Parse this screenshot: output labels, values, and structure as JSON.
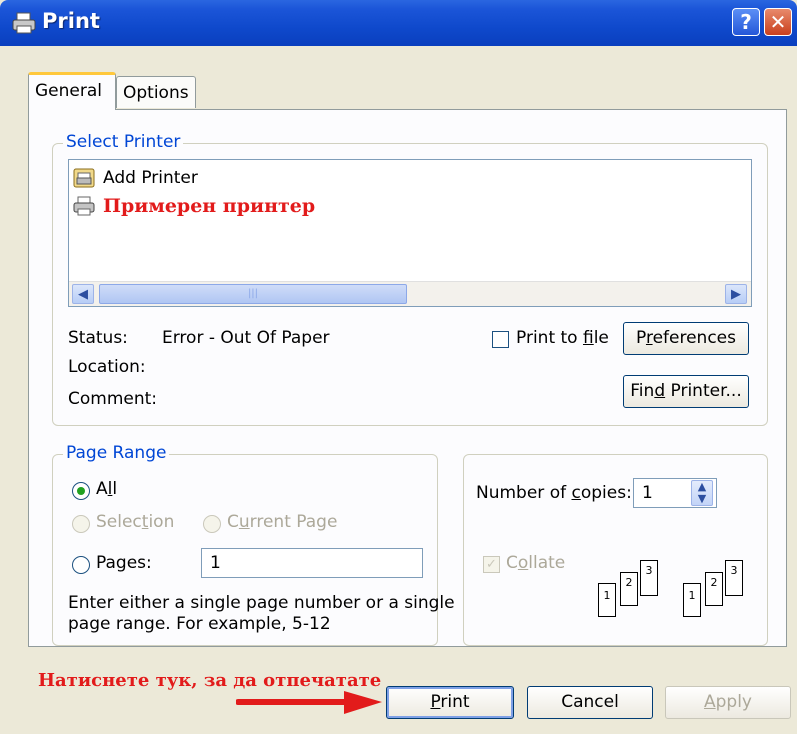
{
  "window": {
    "title": "Print",
    "help_glyph": "?",
    "close_glyph": "✕"
  },
  "tabs": [
    {
      "label": "General",
      "active": true
    },
    {
      "label": "Options",
      "active": false
    }
  ],
  "select_printer": {
    "legend": "Select Printer",
    "items": [
      {
        "label": "Add Printer",
        "icon": "add-printer-icon"
      },
      {
        "label": "Примерен принтер",
        "icon": "printer-icon",
        "color": "#e21b1b"
      }
    ],
    "status_label": "Status:",
    "status_value": "Error - Out Of Paper",
    "location_label": "Location:",
    "comment_label": "Comment:",
    "print_to_file": {
      "label_pre": "Print to ",
      "label_u": "f",
      "label_post": "ile",
      "checked": false
    },
    "preferences": {
      "label_pre": "P",
      "label_u": "r",
      "label_post": "eferences"
    },
    "find_printer": {
      "label_pre": "Fin",
      "label_u": "d",
      "label_post": " Printer..."
    }
  },
  "page_range": {
    "legend": "Page Range",
    "all": {
      "label_pre": "A",
      "label_u": "l",
      "label_post": "l",
      "checked": true
    },
    "selection": {
      "label_pre": "Selec",
      "label_u": "t",
      "label_post": "ion",
      "enabled": false
    },
    "current_page": {
      "label_pre": "C",
      "label_u": "u",
      "label_post": "rrent Page",
      "enabled": false
    },
    "pages": {
      "label": "Pages:",
      "value": "1"
    },
    "hint_line1": "Enter either a single page number or a single",
    "hint_line2": "page range.  For example, 5-12"
  },
  "copies": {
    "label_pre": "Number of ",
    "label_u": "c",
    "label_post": "opies:",
    "value": "1",
    "collate": {
      "label_pre": "C",
      "label_u": "o",
      "label_post": "llate",
      "checked": true,
      "enabled": false
    },
    "collate_pages": [
      "1",
      "2",
      "3"
    ]
  },
  "buttons": {
    "print": {
      "label_u": "P",
      "label_post": "rint"
    },
    "cancel": {
      "label": "Cancel"
    },
    "apply": {
      "label_u": "A",
      "label_post": "pply"
    }
  },
  "annotation": {
    "text": "Натиснете тук, за да отпечатате",
    "color": "#e21b1b"
  }
}
